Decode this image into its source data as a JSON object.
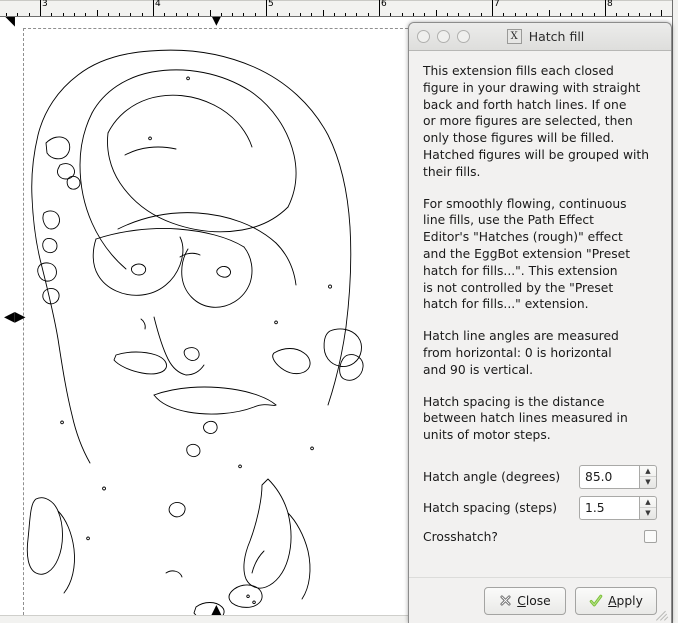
{
  "app": {
    "name": "inkscape-canvas",
    "ruler": {
      "unit_labels": [
        "3",
        "4",
        "5",
        "6",
        "7",
        "8"
      ],
      "label_positions": [
        40,
        153,
        266,
        379,
        492,
        605
      ],
      "major_spacing_px": 113,
      "minor_divisions": 10
    },
    "selection": {
      "handles": [
        "arrow-down-top",
        "arrow-left-right-left",
        "arrow-up-bottom",
        "arrow-corner-topleft"
      ],
      "bbox_label": "selection-bounding-box"
    }
  },
  "dialog": {
    "title": "Hatch fill",
    "title_icon": "X",
    "window_buttons": [
      "close-circle",
      "minimize-circle",
      "maximize-circle"
    ],
    "paragraphs": [
      "This extension fills each closed\nfigure in your drawing with straight\nback and forth hatch lines. If one\nor more figures are selected, then\nonly those figures will be filled.\nHatched figures will be grouped with\ntheir fills.",
      "For smoothly flowing, continuous\nline fills, use the Path Effect\nEditor's \"Hatches (rough)\" effect\nand the EggBot extension \"Preset\nhatch for fills...\". This extension\nis not controlled by the \"Preset\nhatch for fills...\" extension.",
      "Hatch line angles are measured\nfrom horizontal: 0 is horizontal\nand 90 is vertical.",
      "Hatch spacing is the distance\nbetween hatch lines measured in\nunits of motor steps."
    ],
    "fields": {
      "hatch_angle": {
        "label": "Hatch angle (degrees)",
        "value": "85.0"
      },
      "hatch_spacing": {
        "label": "Hatch spacing (steps)",
        "value": "1.5"
      },
      "crosshatch": {
        "label": "Crosshatch?",
        "checked": false
      }
    },
    "buttons": {
      "close": {
        "mnemonic": "C",
        "rest": "lose",
        "icon": "x-mark-icon"
      },
      "apply": {
        "mnemonic": "A",
        "rest": "pply",
        "icon": "check-mark-icon"
      }
    },
    "colors": {
      "window_bg": "#f2f1f0",
      "titlebar_top": "#ececeb",
      "titlebar_bottom": "#dededc",
      "text": "#1a1a1a",
      "border": "#8c8c8c",
      "apply_check": "#7cc13a",
      "close_x": "#666666"
    }
  }
}
